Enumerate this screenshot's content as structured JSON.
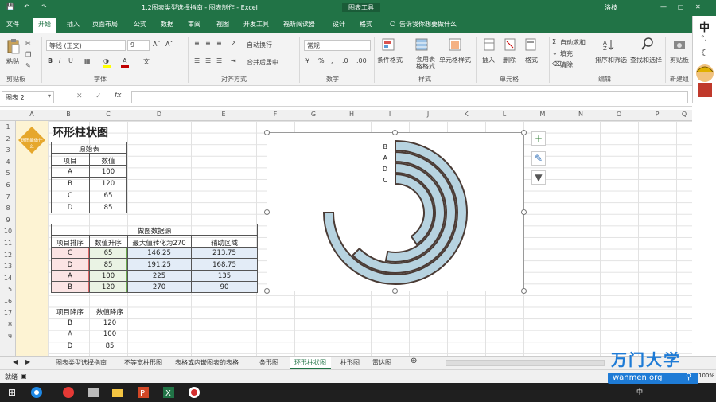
{
  "window": {
    "title": "1.2图表类型选择指南 - 图表制作 - Excel",
    "context_tab": "图表工具",
    "user": "洛枝"
  },
  "ribbon_tabs": [
    "文件",
    "开始",
    "插入",
    "页面布局",
    "公式",
    "数据",
    "审阅",
    "视图",
    "开发工具",
    "福昕阅读器",
    "设计",
    "格式"
  ],
  "tell_me": "告诉我你想要做什么",
  "ribbon": {
    "paste": "粘贴",
    "clipboard": "剪贴板",
    "font_name": "等线 (正文)",
    "font_size": "9",
    "font_group": "字体",
    "wrap_text": "自动换行",
    "merge_center": "合并后居中",
    "align_group": "对齐方式",
    "number_format": "常规",
    "number_group": "数字",
    "conditional_format": "条件格式",
    "format_as_table": "套用表格格式",
    "cell_styles": "单元格样式",
    "styles_group": "样式",
    "insert": "插入",
    "delete": "删除",
    "format": "格式",
    "cells_group": "单元格",
    "autosum": "自动求和",
    "fill": "填充",
    "clear": "清除",
    "sort_filter": "排序和筛选",
    "find_select": "查找和选择",
    "edit_group": "编辑",
    "screenshot": "剪贴板",
    "new_group": "新建组",
    "font_color": "#c00000",
    "fill_color": "#ffff00"
  },
  "formula_bar": {
    "name_box": "图表 2",
    "fx": "fx",
    "content": ""
  },
  "columns": [
    "A",
    "B",
    "C",
    "D",
    "E",
    "F",
    "G",
    "H",
    "I",
    "J",
    "K",
    "L",
    "M",
    "N",
    "O",
    "P",
    "Q"
  ],
  "rows": [
    "1",
    "2",
    "3",
    "4",
    "5",
    "6",
    "7",
    "8",
    "9",
    "10",
    "11",
    "12",
    "13",
    "14",
    "15",
    "16",
    "17",
    "18",
    "19"
  ],
  "sheet": {
    "logo_text": "玩图能做什么",
    "title": "环形柱状图",
    "table1": {
      "caption": "原始表",
      "headers": [
        "项目",
        "数值"
      ],
      "rows": [
        [
          "A",
          "100"
        ],
        [
          "B",
          "120"
        ],
        [
          "C",
          "65"
        ],
        [
          "D",
          "85"
        ]
      ]
    },
    "table2": {
      "caption": "做图数据源",
      "headers": [
        "项目排序",
        "数值升序",
        "最大值转化为270",
        "辅助区域"
      ],
      "rows": [
        [
          "C",
          "65",
          "146.25",
          "213.75"
        ],
        [
          "D",
          "85",
          "191.25",
          "168.75"
        ],
        [
          "A",
          "100",
          "225",
          "135"
        ],
        [
          "B",
          "120",
          "270",
          "90"
        ]
      ]
    },
    "table3": {
      "headers": [
        "项目降序",
        "数值降序"
      ],
      "rows": [
        [
          "B",
          "120"
        ],
        [
          "A",
          "100"
        ],
        [
          "D",
          "85"
        ]
      ]
    }
  },
  "chart_data": {
    "type": "ring-bar",
    "categories": [
      "B",
      "A",
      "D",
      "C"
    ],
    "values": [
      270,
      225,
      191.25,
      146.25
    ],
    "max_angle": 270,
    "fill_color": "#b7d3e0",
    "stroke_color": "#4a3b35"
  },
  "sheet_tabs": [
    "图表类型选择指南",
    "不等宽柱形图",
    "表格或内嵌图表的表格",
    "条形图",
    "环形柱状图",
    "柱形图",
    "雷达图"
  ],
  "active_sheet": "环形柱状图",
  "status": {
    "left": "就绪",
    "zoom": "100%"
  },
  "watermark": {
    "brand": "万门大学",
    "url": "wanmen.org"
  },
  "ime": {
    "lang": "中"
  }
}
